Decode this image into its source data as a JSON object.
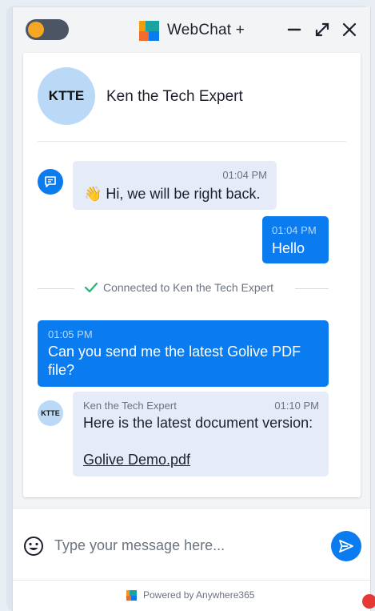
{
  "header": {
    "title": "WebChat +",
    "toggle_state": "off",
    "controls": [
      "minimize-icon",
      "expand-icon",
      "close-icon"
    ]
  },
  "agent": {
    "initials": "KTTE",
    "name": "Ken the Tech Expert"
  },
  "messages": [
    {
      "direction": "in",
      "time": "01:04 PM",
      "text": "👋 Hi, we will be right back."
    },
    {
      "direction": "out",
      "time": "01:04 PM",
      "text": "Hello"
    },
    {
      "direction": "system",
      "text": "Connected to Ken the Tech Expert"
    },
    {
      "direction": "out",
      "time": "01:05 PM",
      "text": "Can you send me the latest Golive PDF file?"
    },
    {
      "direction": "in",
      "sender": "Ken the Tech Expert",
      "time": "01:10 PM",
      "text": "Here is the latest document version:",
      "attachment": "Golive Demo.pdf"
    }
  ],
  "composer": {
    "placeholder": "Type your message here...",
    "value": ""
  },
  "footer": {
    "powered_by": "Powered by Anywhere365"
  },
  "colors": {
    "accent": "#0a7cf0",
    "incoming_bubble": "#e5ecf7",
    "avatar": "#b9d9f7",
    "toggle_knob": "#f5a623",
    "check": "#22b573"
  }
}
